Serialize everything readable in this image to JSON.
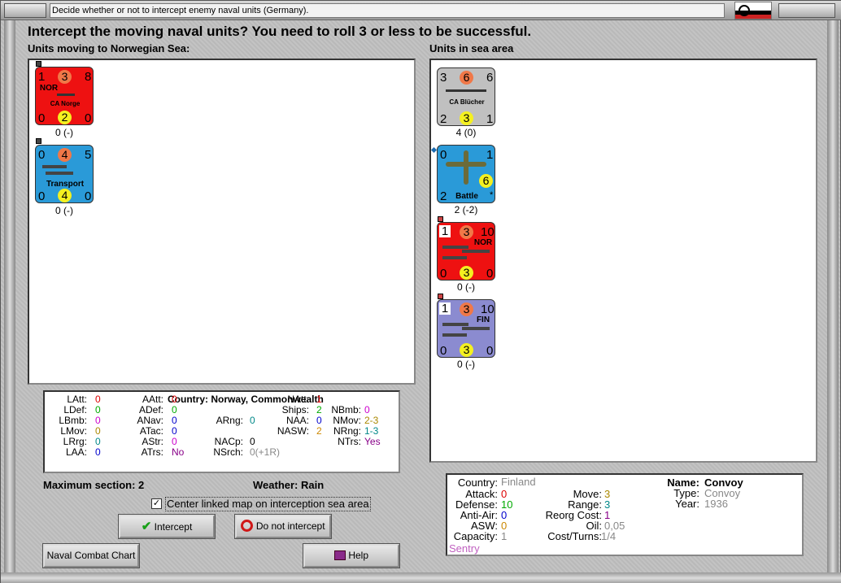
{
  "window": {
    "title": "Decide whether or not to intercept enemy naval units (Germany)."
  },
  "headline": "Intercept the moving naval units?  You need to roll 3 or less to be successful.",
  "left_panel": {
    "title": "Units moving to Norwegian Sea:",
    "units": [
      {
        "tl": "1",
        "tc": "3",
        "tr": "8",
        "bl": "0",
        "bc": "2",
        "br": "0",
        "nation": "NOR",
        "name": "CA Norge",
        "sub": "0 (-)",
        "bg": "#ee1111"
      },
      {
        "tl": "0",
        "tc": "4",
        "tr": "5",
        "bl": "0",
        "bc": "4",
        "br": "0",
        "name": "Transport",
        "sub": "0 (-)",
        "bg": "#2a9ad8"
      }
    ]
  },
  "right_panel": {
    "title": "Units in sea area",
    "units": [
      {
        "tl": "3",
        "tc": "6",
        "tr": "6",
        "bl": "2",
        "bc": "3",
        "br": "1",
        "name": "CA Blücher",
        "sub": "4 (0)",
        "bg": "#c0c0c0"
      },
      {
        "tl": "0",
        "tr": "1",
        "bl": "2",
        "rc": "6",
        "name": "Battle",
        "star": "*",
        "sub": "2 (-2)",
        "bg": "#2a9ad8"
      },
      {
        "tl": "1",
        "tc": "3",
        "tr": "10",
        "bl": "0",
        "bc": "3",
        "br": "0",
        "nation": "NOR",
        "sub": "0 (-)",
        "bg": "#ee1111"
      },
      {
        "tl": "1",
        "tc": "3",
        "tr": "10",
        "bl": "0",
        "bc": "3",
        "br": "0",
        "nation": "FIN",
        "sub": "0 (-)",
        "bg": "#8b8bd0"
      }
    ]
  },
  "stats": {
    "country_label": "Country: Norway, Commonwealth",
    "col1": [
      {
        "k": "LAtt:",
        "v": "0",
        "c": "#dd0000"
      },
      {
        "k": "LDef:",
        "v": "0",
        "c": "#00aa00"
      },
      {
        "k": "LBmb:",
        "v": "0",
        "c": "#cc00cc"
      },
      {
        "k": "LMov:",
        "v": "0",
        "c": "#aa8800"
      },
      {
        "k": "LRrg:",
        "v": "0",
        "c": "#008888"
      },
      {
        "k": "LAA:",
        "v": "0",
        "c": "#0000cc"
      }
    ],
    "col2": [
      {
        "k": "AAtt:",
        "v": "0",
        "c": "#dd0000"
      },
      {
        "k": "ADef:",
        "v": "0",
        "c": "#00aa00"
      },
      {
        "k": "ANav:",
        "v": "0",
        "c": "#0000cc"
      },
      {
        "k": "ATac:",
        "v": "0",
        "c": "#0000cc"
      },
      {
        "k": "AStr:",
        "v": "0",
        "c": "#cc00cc"
      },
      {
        "k": "ATrs:",
        "v": "No",
        "c": "#880088"
      }
    ],
    "col3": [
      {
        "k": "ARng:",
        "v": "0",
        "c": "#008888"
      },
      {
        "k": "NACp:",
        "v": "0",
        "c": "#000000"
      },
      {
        "k": "NSrch:",
        "v": "0(+1R)",
        "c": "#888888"
      }
    ],
    "col4": [
      {
        "k": "NAtt:",
        "v": "1",
        "c": "#dd0000"
      },
      {
        "k": "Ships:",
        "v": "2",
        "c": "#00aa00"
      },
      {
        "k": "NAA:",
        "v": "0",
        "c": "#0000cc"
      },
      {
        "k": "NASW:",
        "v": "2",
        "c": "#cc8800"
      }
    ],
    "col5": [
      {
        "k": "NBmb:",
        "v": "0",
        "c": "#cc00cc"
      },
      {
        "k": "NMov:",
        "v": "2-3",
        "c": "#aa8800"
      },
      {
        "k": "NRng:",
        "v": "1-3",
        "c": "#008888"
      },
      {
        "k": "NTrs:",
        "v": "Yes",
        "c": "#880088"
      }
    ]
  },
  "max_section": "Maximum section: 2",
  "weather": "Weather:  Rain",
  "center_checkbox": {
    "label": "Center linked map on interception sea area",
    "checked": true
  },
  "buttons": {
    "intercept": "Intercept",
    "do_not_intercept": "Do not intercept",
    "naval_combat_chart": "Naval Combat Chart",
    "help": "Help"
  },
  "info": {
    "country_k": "Country:",
    "country_v": "Finland",
    "attack_k": "Attack:",
    "attack_v": "0",
    "defense_k": "Defense:",
    "defense_v": "10",
    "antiair_k": "Anti-Air:",
    "antiair_v": "0",
    "asw_k": "ASW:",
    "asw_v": "0",
    "capacity_k": "Capacity:",
    "capacity_v": "1",
    "sentry": "Sentry",
    "name_k": "Name:",
    "name_v": "Convoy",
    "type_k": "Type:",
    "type_v": "Convoy",
    "year_k": "Year:",
    "year_v": "1936",
    "move_k": "Move:",
    "move_v": "3",
    "range_k": "Range:",
    "range_v": "3",
    "reorg_k": "Reorg Cost:",
    "reorg_v": "1",
    "oil_k": "Oil:",
    "oil_v": "0,05",
    "costturns_k": "Cost/Turns:",
    "costturns_v": "1/4"
  }
}
